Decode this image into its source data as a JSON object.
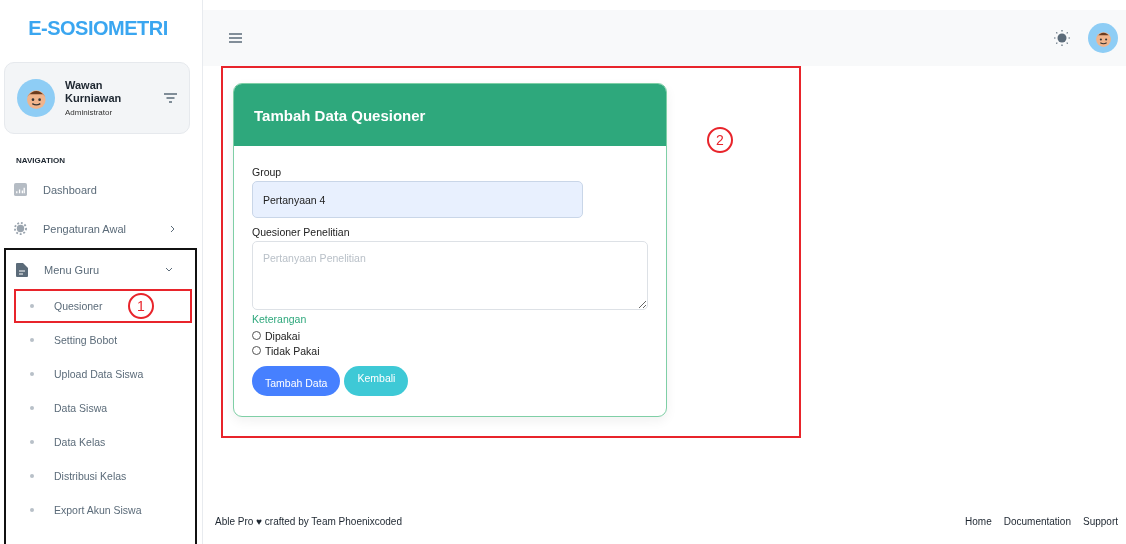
{
  "sidebar": {
    "logo": "E-SOSIOMETRI",
    "user": {
      "name": "Wawan Kurniawan",
      "role": "Administrator"
    },
    "section_title": "NAVIGATION",
    "items": [
      {
        "label": "Dashboard",
        "kind": "link"
      },
      {
        "label": "Pengaturan Awal",
        "kind": "group",
        "expanded": false,
        "outlined": false
      },
      {
        "label": "Menu Guru",
        "kind": "group",
        "expanded": true,
        "outlined": true,
        "children": [
          {
            "label": "Quesioner",
            "selected": false,
            "callout": "1"
          },
          {
            "label": "Setting Bobot",
            "selected": false
          },
          {
            "label": "Upload Data Siswa",
            "selected": false
          },
          {
            "label": "Data Siswa",
            "selected": false
          },
          {
            "label": "Data Kelas",
            "selected": false
          },
          {
            "label": "Distribusi Kelas",
            "selected": false
          },
          {
            "label": "Export Akun Siswa",
            "selected": false
          }
        ]
      }
    ]
  },
  "content": {
    "callout": "2",
    "card": {
      "title": "Tambah Data Quesioner",
      "fields": [
        {
          "kind": "text",
          "label": "Group",
          "value": "Pertanyaan 4"
        },
        {
          "kind": "textarea",
          "label": "Quesioner Penelitian",
          "placeholder": "Pertanyaan Penelitian"
        }
      ],
      "radio_group": {
        "label": "Keterangan",
        "options": [
          {
            "label": "Dipakai",
            "selected": false
          },
          {
            "label": "Tidak Pakai",
            "selected": false
          }
        ]
      },
      "buttons": [
        {
          "label": "Tambah Data",
          "kind": "primary"
        },
        {
          "label": "Kembali",
          "kind": "info"
        }
      ]
    }
  },
  "footer": {
    "credit": "Able Pro ♥ crafted by Team Phoenixcoded",
    "links": [
      "Home",
      "Documentation",
      "Support"
    ]
  }
}
